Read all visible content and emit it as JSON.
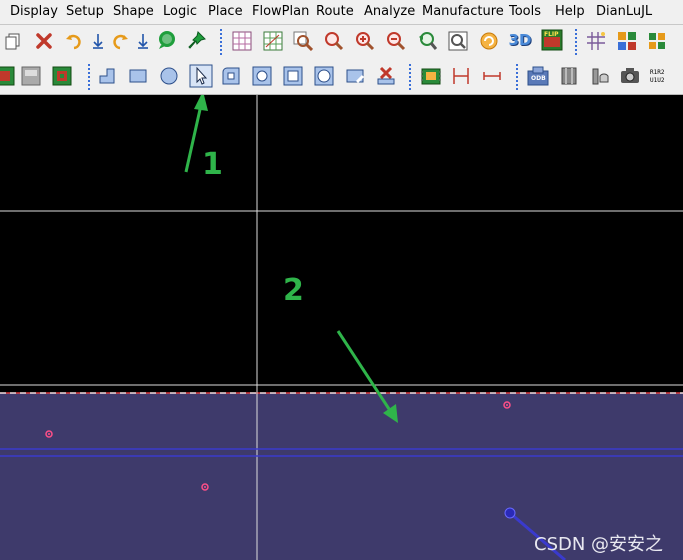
{
  "menubar": {
    "items": [
      "Display",
      "Setup",
      "Shape",
      "Logic",
      "Place",
      "FlowPlan",
      "Route",
      "Analyze",
      "Manufacture",
      "Tools",
      "Help",
      "DianLuJL"
    ]
  },
  "toolbar1": {
    "icons": [
      "copy-icon",
      "delete-icon",
      "undo-icon",
      "arrow-down-icon",
      "redo-icon",
      "arrow-down-icon",
      "bubble-icon",
      "pin-icon",
      "grid-view-icon",
      "grid-ratsnest-icon",
      "zoom-fit-icon",
      "zoom-point-icon",
      "zoom-in-icon",
      "zoom-out-icon",
      "zoom-prev-icon",
      "zoom-world-icon",
      "redraw-icon",
      "3d-view-icon",
      "flip-icon",
      "grid-toggle-icon",
      "color-icon",
      "layers-icon"
    ],
    "labels": {
      "3d": "3D",
      "flip": "FLIP"
    }
  },
  "toolbar2": {
    "icons": [
      "shape-fill-icon",
      "shape-gray-icon",
      "shape-green-icon",
      "add-line-icon",
      "add-rect-icon",
      "add-circle-icon",
      "select-icon",
      "add-frect-icon",
      "add-circle2-icon",
      "add-square-icon",
      "add-oval-icon",
      "edit-shape-icon",
      "delete-shape-icon",
      "place-component-icon",
      "dimension-icon",
      "measure-icon",
      "odb-export-icon",
      "film-icon",
      "library-icon",
      "camera-icon",
      "refdes-icon"
    ],
    "labels": {
      "odb": "ODB"
    }
  },
  "canvas": {
    "background": "#000000",
    "board_color": "#3e3a6b",
    "grid_color": "#ffffff",
    "dashed_line_color": "#ff4040",
    "via_color": "#ff4f88",
    "trace_color": "#3a3acd"
  },
  "annotations": [
    {
      "label": "1",
      "color": "#2fb44a"
    },
    {
      "label": "2",
      "color": "#2fb44a"
    }
  ],
  "watermark": {
    "text": "CSDN @安安之"
  }
}
